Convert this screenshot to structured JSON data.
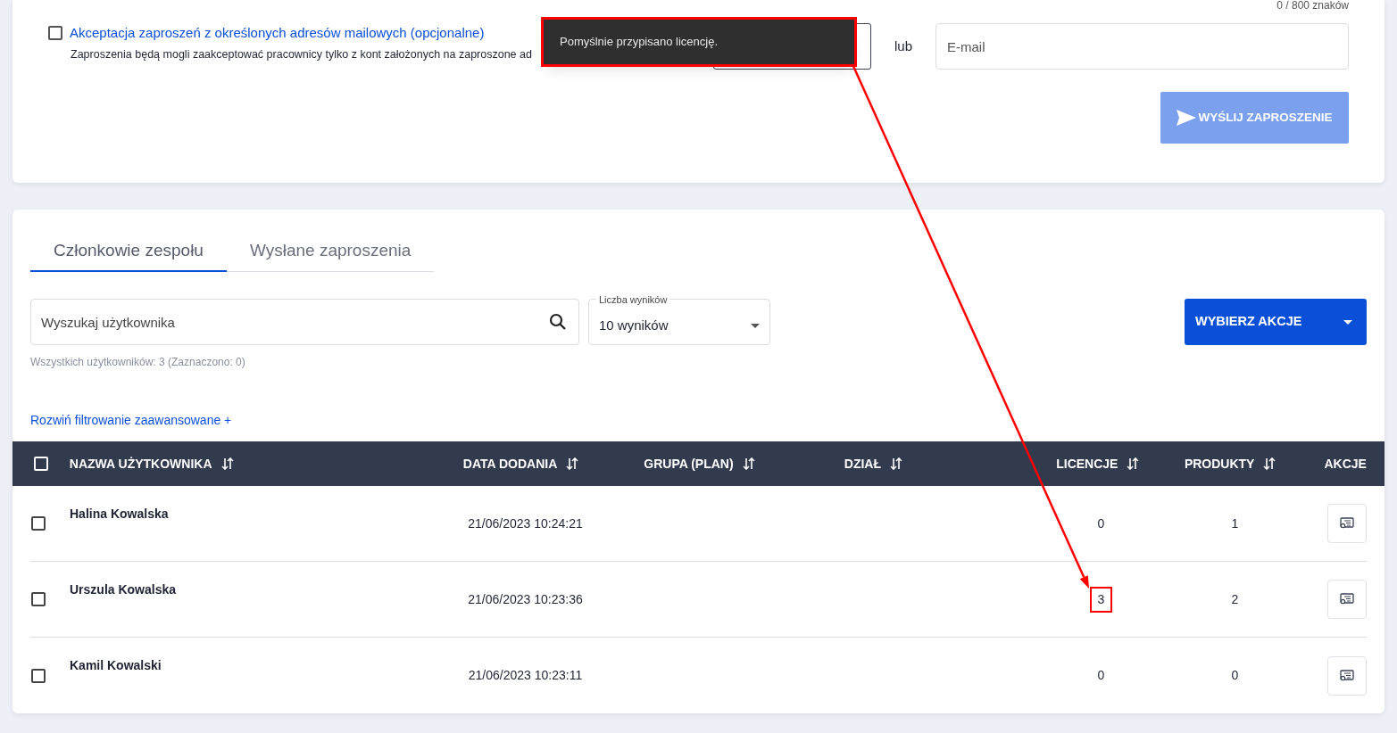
{
  "invite": {
    "char_count": "0 / 800 znaków",
    "restrict_checkbox": {
      "label": "Akceptacja zaproszeń z określonych adresów mailowych (opcjonalne)",
      "checked": false,
      "description": "Zaproszenia będą mogli zaakceptować pracownicy tylko z kont założonych na zaproszone ad"
    },
    "or_label": "lub",
    "email": {
      "placeholder": "E-mail"
    },
    "send_button": {
      "label": "WYŚLIJ ZAPROSZENIE",
      "disabled": true
    }
  },
  "toast": {
    "message": "Pomyślnie przypisano licencję.",
    "highlighted": true
  },
  "tabs": [
    {
      "label": "Członkowie zespołu",
      "selected": true
    },
    {
      "label": "Wysłane zaproszenia",
      "selected": false
    }
  ],
  "search": {
    "placeholder": "Wyszukaj użytkownika"
  },
  "results_select": {
    "label": "Liczba wyników",
    "value": "10 wyników"
  },
  "summary": "Wszystkich użytkowników: 3 (Zaznaczono: 0)",
  "advanced_filter_link": "Rozwiń filtrowanie zaawansowane +",
  "actions_button": "WYBIERZ AKCJE",
  "table": {
    "select_all": false,
    "columns": [
      {
        "label": "NAZWA UŻYTKOWNIKA",
        "sortable": true
      },
      {
        "label": "DATA DODANIA",
        "sortable": true
      },
      {
        "label": "GRUPA (PLAN)",
        "sortable": true
      },
      {
        "label": "DZIAŁ",
        "sortable": true
      },
      {
        "label": "LICENCJE",
        "sortable": true
      },
      {
        "label": "PRODUKTY",
        "sortable": true
      },
      {
        "label": "AKCJE",
        "sortable": false
      }
    ],
    "rows": [
      {
        "selected": false,
        "name": "Halina Kowalska",
        "date": "21/06/2023 10:24:21",
        "licenses": "0",
        "licenses_highlighted": false,
        "products": "1"
      },
      {
        "selected": false,
        "name": "Urszula Kowalska",
        "date": "21/06/2023 10:23:36",
        "licenses": "3",
        "licenses_highlighted": true,
        "products": "2"
      },
      {
        "selected": false,
        "name": "Kamil Kowalski",
        "date": "21/06/2023 10:23:11",
        "licenses": "0",
        "licenses_highlighted": false,
        "products": "0"
      }
    ]
  }
}
